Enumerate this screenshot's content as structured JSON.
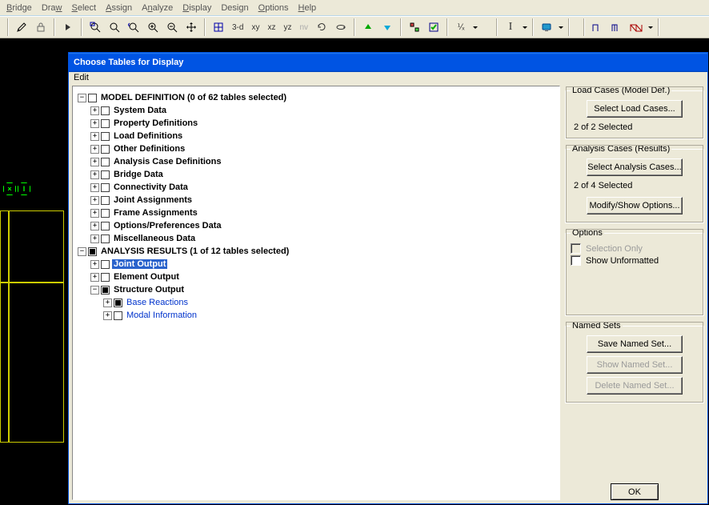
{
  "menus": [
    "Bridge",
    "Draw",
    "Select",
    "Assign",
    "Analyze",
    "Display",
    "Design",
    "Options",
    "Help"
  ],
  "toolbar": {
    "view3d": "3-d",
    "viewXY": "xy",
    "viewXZ": "xz",
    "viewYZ": "yz",
    "viewNV": "nv"
  },
  "dialog": {
    "title": "Choose Tables for Display",
    "menu": "Edit",
    "tree": {
      "model_def": "MODEL DEFINITION  (0 of 62 tables selected)",
      "system_data": "System Data",
      "property_defs": "Property Definitions",
      "load_defs": "Load Definitions",
      "other_defs": "Other Definitions",
      "analysis_case_defs": "Analysis Case Definitions",
      "bridge_data": "Bridge Data",
      "connectivity_data": "Connectivity Data",
      "joint_assignments": "Joint Assignments",
      "frame_assignments": "Frame Assignments",
      "options_prefs": "Options/Preferences Data",
      "misc_data": "Miscellaneous Data",
      "analysis_results": "ANALYSIS RESULTS  (1 of 12 tables selected)",
      "joint_output": "Joint Output",
      "element_output": "Element Output",
      "structure_output": "Structure Output",
      "base_reactions": "Base Reactions",
      "modal_information": "Modal Information"
    },
    "groups": {
      "load_cases": {
        "legend": "Load Cases (Model Def.)",
        "button": "Select Load Cases...",
        "status": "2 of 2 Selected"
      },
      "analysis_cases": {
        "legend": "Analysis Cases (Results)",
        "button": "Select Analysis Cases...",
        "status": "2 of 4 Selected",
        "modify_button": "Modify/Show Options..."
      },
      "options": {
        "legend": "Options",
        "selection_only": "Selection Only",
        "show_unformatted": "Show Unformatted"
      },
      "named_sets": {
        "legend": "Named Sets",
        "save": "Save Named Set...",
        "show": "Show Named Set...",
        "delete": "Delete Named Set..."
      }
    },
    "ok": "OK"
  }
}
